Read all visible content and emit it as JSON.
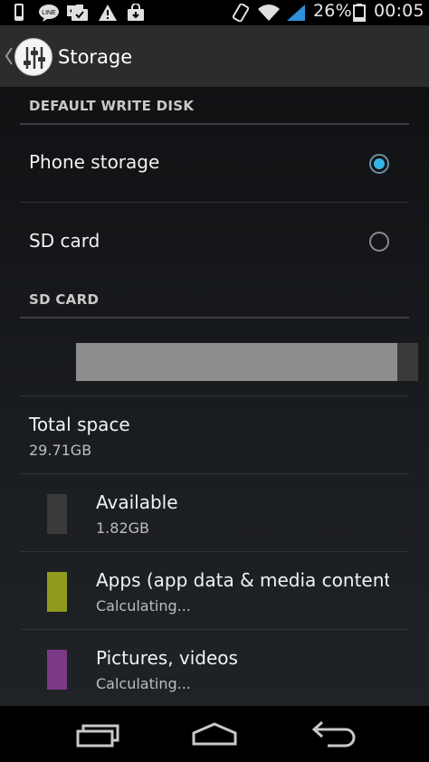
{
  "status_bar": {
    "battery_percent": "26%",
    "time": "00:05",
    "icons": [
      "phone-icon",
      "line-app-icon",
      "bbm-icon",
      "briefcase-icon",
      "warning-icon",
      "shopping-bag-icon",
      "rotate-icon",
      "wifi-icon",
      "signal-icon",
      "battery-icon"
    ]
  },
  "action_bar": {
    "title": "Storage",
    "icon": "equalizer-settings-icon"
  },
  "default_write_disk": {
    "header": "DEFAULT WRITE DISK",
    "options": [
      {
        "label": "Phone storage",
        "selected": true
      },
      {
        "label": "SD card",
        "selected": false
      }
    ]
  },
  "sd_card": {
    "header": "SD CARD",
    "usage_fraction": 0.94,
    "total": {
      "title": "Total space",
      "value": "29.71GB"
    },
    "categories": [
      {
        "title": "Available",
        "value": "1.82GB",
        "color": "#3a3a3a"
      },
      {
        "title": "Apps (app data & media content)",
        "value": "Calculating...",
        "color": "#8f9a1f"
      },
      {
        "title": "Pictures, videos",
        "value": "Calculating...",
        "color": "#7b3a86"
      }
    ]
  },
  "nav_bar": {
    "buttons": [
      "recent-apps-icon",
      "home-icon",
      "back-icon"
    ]
  }
}
